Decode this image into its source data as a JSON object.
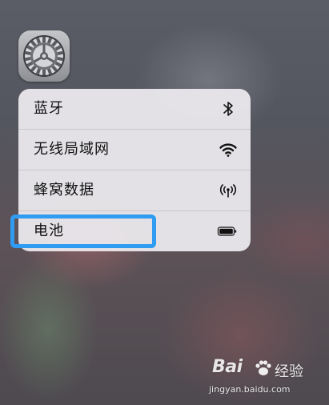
{
  "app": {
    "icon": "settings-gear-icon"
  },
  "menu": {
    "items": [
      {
        "label": "蓝牙",
        "icon": "bluetooth-icon"
      },
      {
        "label": "无线局域网",
        "icon": "wifi-icon"
      },
      {
        "label": "蜂窝数据",
        "icon": "cellular-antenna-icon"
      },
      {
        "label": "电池",
        "icon": "battery-icon"
      }
    ]
  },
  "annotation": {
    "color": "#2f9cf2",
    "target": "电池"
  },
  "watermark": {
    "brand": "Bai",
    "suffix": "经验",
    "url": "jingyan.baidu.com"
  }
}
